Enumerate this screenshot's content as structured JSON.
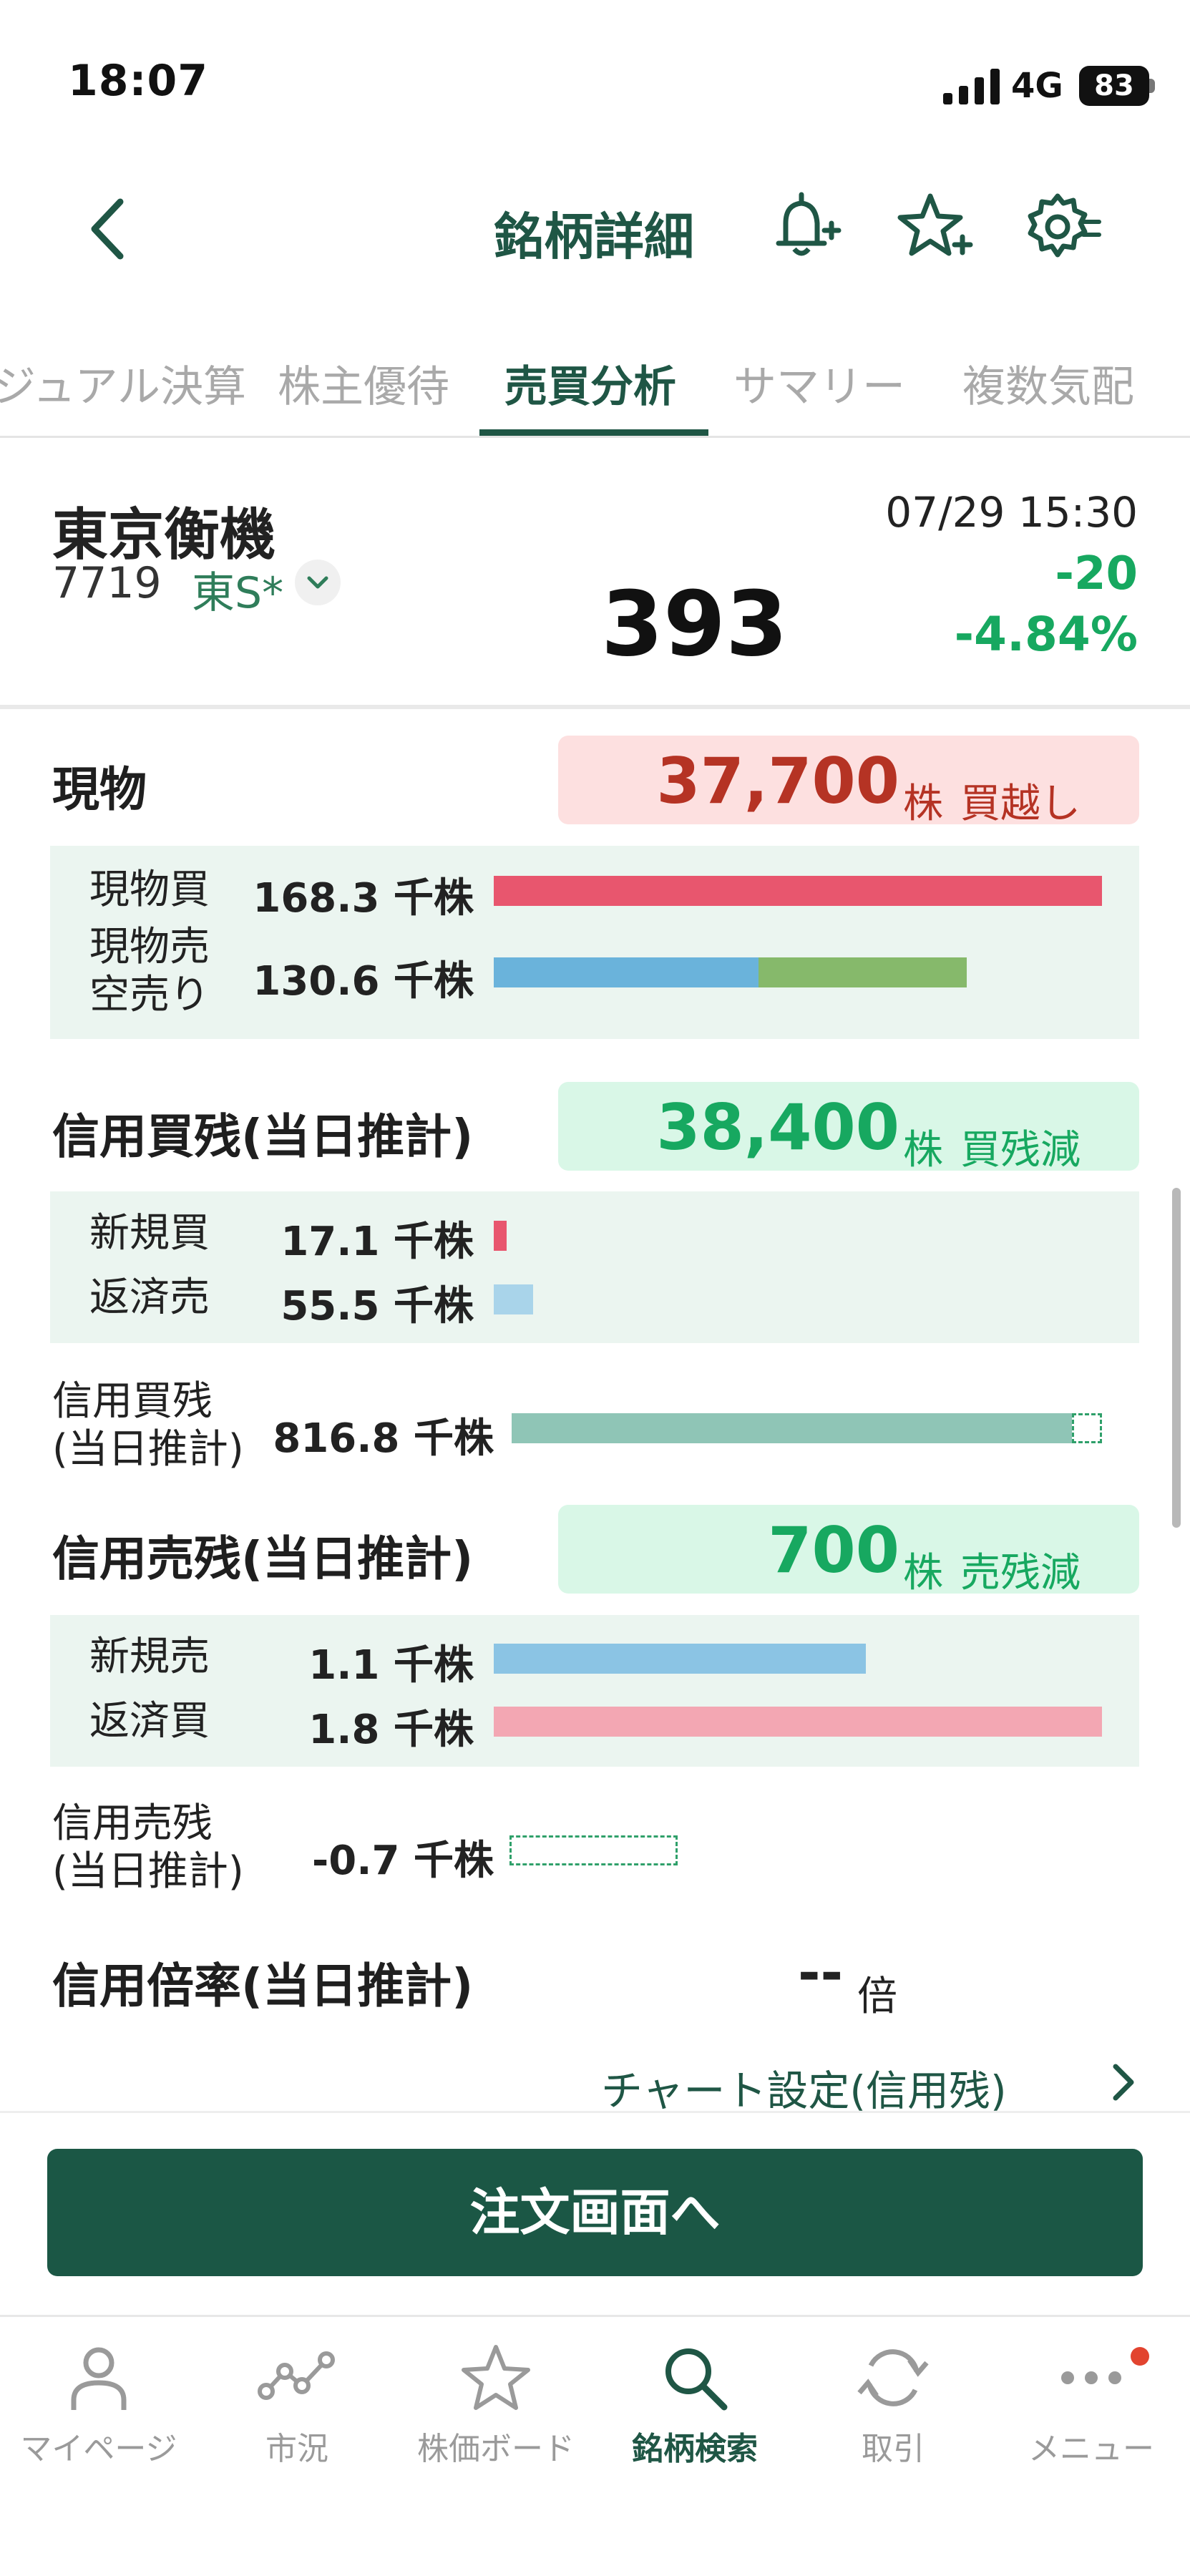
{
  "status_bar": {
    "time": "18:07",
    "network": "4G",
    "battery": "83"
  },
  "header": {
    "title": "銘柄詳細"
  },
  "tabs": [
    {
      "label": "ビジュアル決算"
    },
    {
      "label": "株主優待"
    },
    {
      "label": "売買分析",
      "active": true
    },
    {
      "label": "サマリー"
    },
    {
      "label": "複数気配"
    }
  ],
  "stock": {
    "name": "東京衡機",
    "code": "7719",
    "market": "東S*",
    "price": "393",
    "time": "07/29 15:30",
    "change": "-20",
    "change_pct": "-4.84%"
  },
  "spot": {
    "title": "現物",
    "summary_value": "37,700",
    "summary_unit": "株",
    "summary_label": "買越し",
    "rows": [
      {
        "label": "現物買",
        "value": "168.3 千株",
        "fill": 1.0
      },
      {
        "label": "現物売\n空売り",
        "value": "130.6 千株",
        "fill_sell": 0.436,
        "fill_short": 0.35
      }
    ]
  },
  "margin_buy": {
    "title": "信用買残(当日推計)",
    "summary_value": "38,400",
    "summary_unit": "株",
    "summary_label": "買残減",
    "rows": [
      {
        "label": "新規買",
        "value": "17.1 千株",
        "fill": 0.02
      },
      {
        "label": "返済売",
        "value": "55.5 千株",
        "fill": 0.065
      }
    ],
    "balance_label": "信用買残\n(当日推計)",
    "balance_value": "816.8 千株"
  },
  "margin_sell": {
    "title": "信用売残(当日推計)",
    "summary_value": "700",
    "summary_unit": "株",
    "summary_label": "売残減",
    "rows": [
      {
        "label": "新規売",
        "value": "1.1 千株",
        "fill": 0.61
      },
      {
        "label": "返済買",
        "value": "1.8 千株",
        "fill": 1.0
      }
    ],
    "balance_label": "信用売残\n(当日推計)",
    "balance_value": "-0.7 千株"
  },
  "margin_ratio": {
    "title": "信用倍率(当日推計)",
    "value": "--",
    "unit": "倍"
  },
  "chart_link": "チャート設定(信用残)",
  "order_button": "注文画面へ",
  "bottom_nav": [
    {
      "label": "マイページ",
      "icon": "person-icon"
    },
    {
      "label": "市況",
      "icon": "market-icon"
    },
    {
      "label": "株価ボード",
      "icon": "star-icon"
    },
    {
      "label": "銘柄検索",
      "icon": "search-icon",
      "active": true
    },
    {
      "label": "取引",
      "icon": "refresh-icon"
    },
    {
      "label": "メニュー",
      "icon": "more-icon"
    }
  ],
  "colors": {
    "accent": "#1f5645",
    "up_red": "#c0392b",
    "down_green": "#17a860",
    "buy_bar": "#e8566e",
    "sell_bar": "#6ab3db",
    "short_bar": "#86b96b",
    "balance_bar": "#8fc5b6"
  }
}
